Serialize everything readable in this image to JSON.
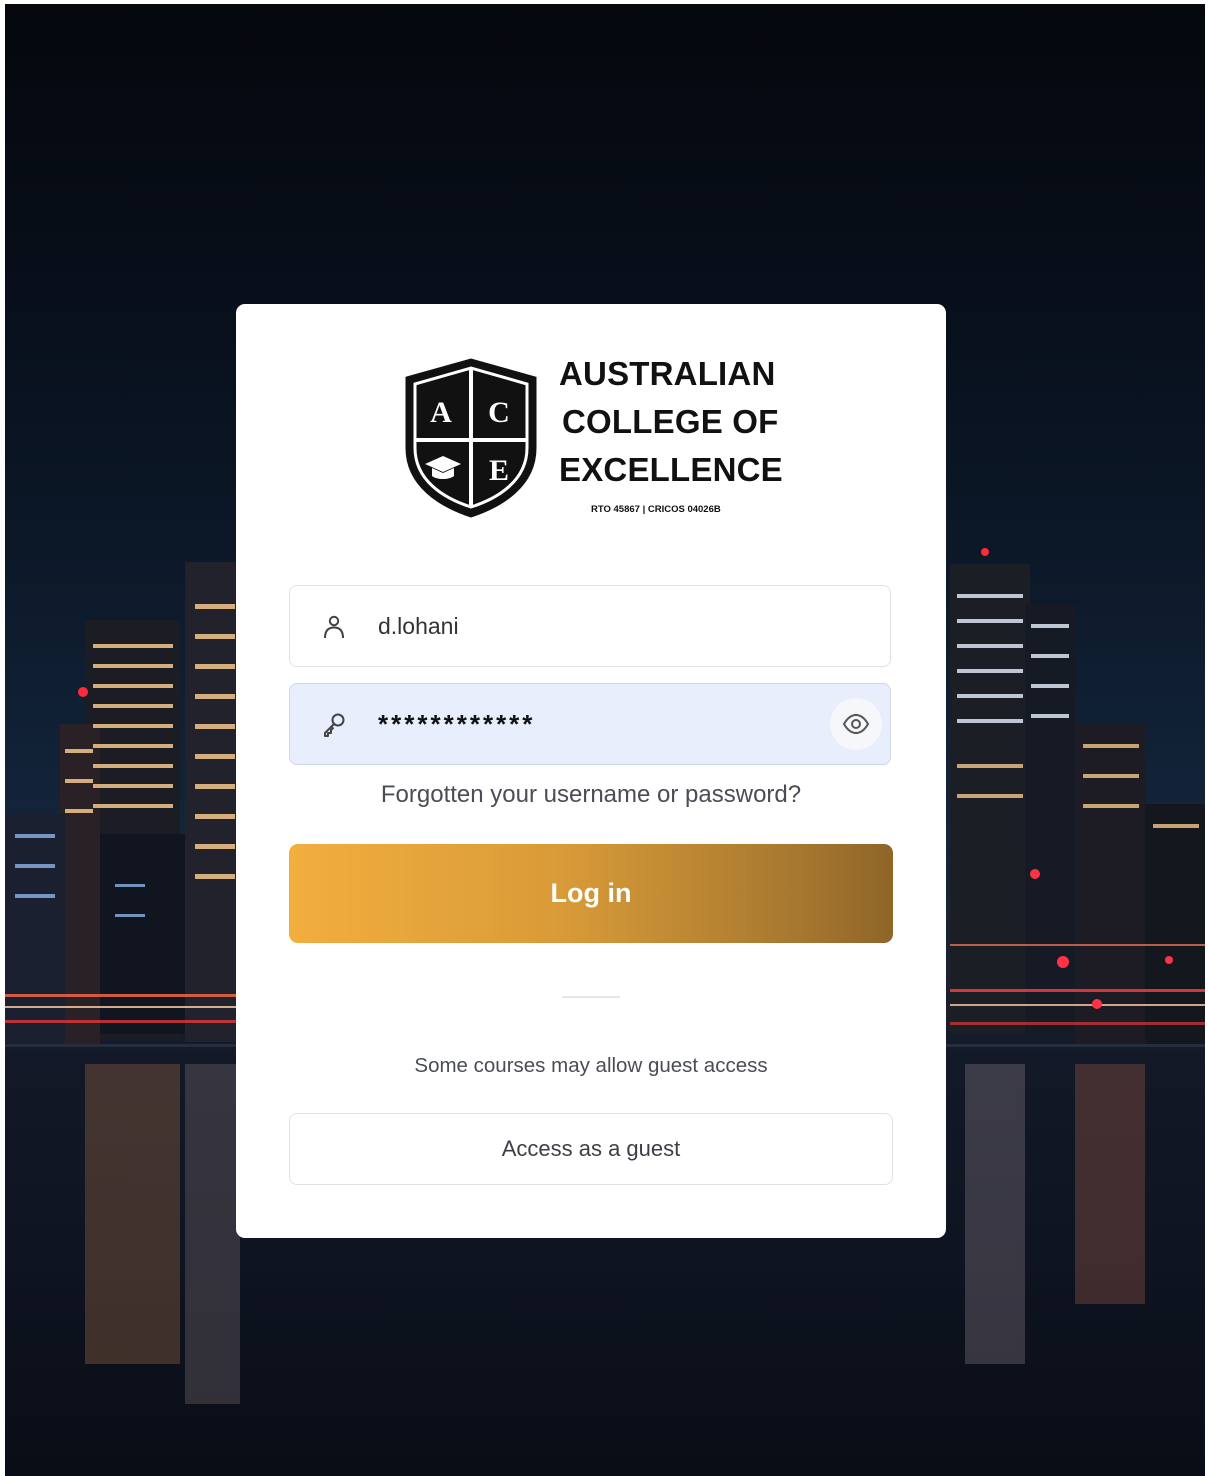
{
  "logo": {
    "lines": [
      "AUSTRALIAN",
      "COLLEGE OF",
      "EXCELLENCE"
    ],
    "registration": "RTO 45867 | CRICOS 04026B",
    "crest_letters": [
      "A",
      "C",
      "E"
    ]
  },
  "login": {
    "username_value": "d.lohani",
    "password_value": "************",
    "forgot_link": "Forgotten your username or password?",
    "login_button": "Log in"
  },
  "guest": {
    "note": "Some courses may allow guest access",
    "button": "Access as a guest"
  },
  "colors": {
    "login_gradient_start": "#f2ae3e",
    "login_gradient_end": "#8f6528",
    "password_field_bg": "#e8eefb"
  },
  "icons": {
    "username": "user-icon",
    "password": "key-icon",
    "reveal": "eye-icon"
  }
}
